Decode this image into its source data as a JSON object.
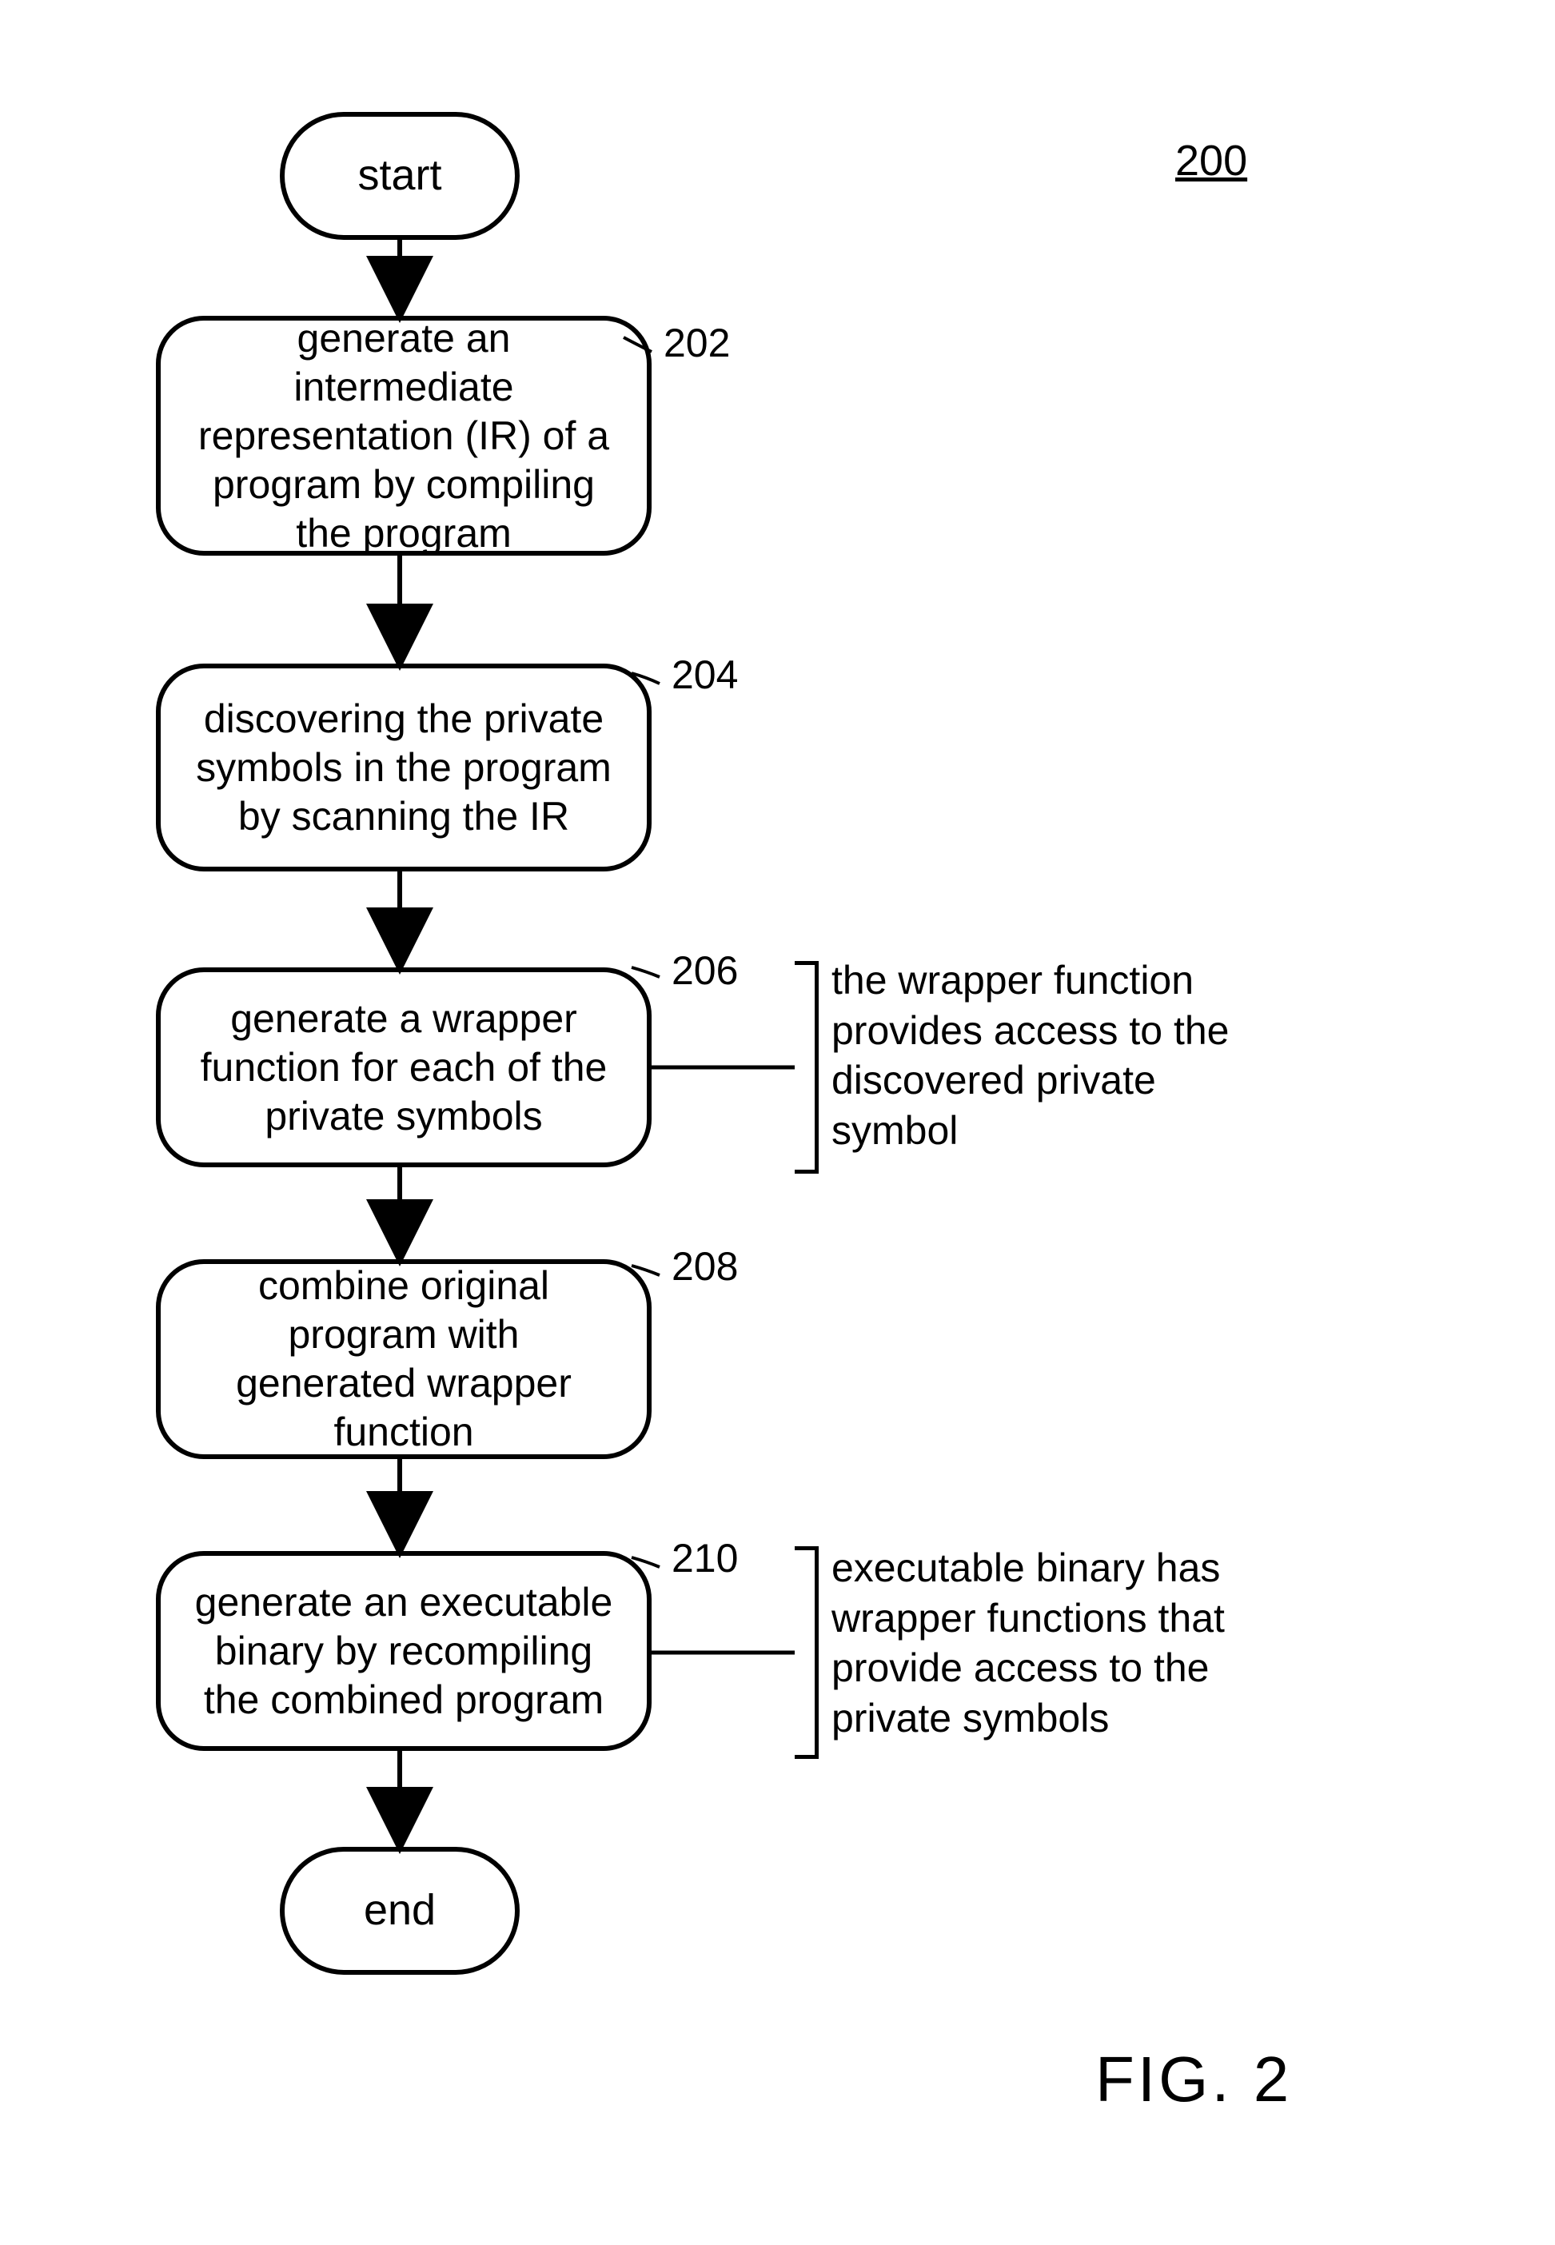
{
  "page_label": "200",
  "figure_label": "FIG. 2",
  "nodes": {
    "start": "start",
    "end": "end",
    "step202": {
      "label": "202",
      "text": "generate an intermediate representation (IR) of a program by compiling the program"
    },
    "step204": {
      "label": "204",
      "text": "discovering the private symbols in the program by scanning the IR"
    },
    "step206": {
      "label": "206",
      "text": "generate a wrapper function for each of the private symbols"
    },
    "step208": {
      "label": "208",
      "text": "combine original program with generated wrapper function"
    },
    "step210": {
      "label": "210",
      "text": "generate an executable binary by recompiling the combined program"
    }
  },
  "annotations": {
    "note206": "the wrapper function provides access to the discovered private symbol",
    "note210": "executable binary has wrapper functions that provide access to the private symbols"
  },
  "chart_data": {
    "type": "flowchart",
    "title": "FIG. 2",
    "reference_numeral": "200",
    "nodes": [
      {
        "id": "start",
        "kind": "terminal",
        "label": "start"
      },
      {
        "id": "202",
        "kind": "process",
        "label": "generate an intermediate representation (IR) of a program by compiling the program"
      },
      {
        "id": "204",
        "kind": "process",
        "label": "discovering the private symbols in the program by scanning the IR"
      },
      {
        "id": "206",
        "kind": "process",
        "label": "generate a wrapper function for each of the private symbols",
        "annotation": "the wrapper function provides access to the discovered private symbol"
      },
      {
        "id": "208",
        "kind": "process",
        "label": "combine original program with generated wrapper function"
      },
      {
        "id": "210",
        "kind": "process",
        "label": "generate an executable binary by recompiling the combined program",
        "annotation": "executable binary has wrapper functions that provide access to the private symbols"
      },
      {
        "id": "end",
        "kind": "terminal",
        "label": "end"
      }
    ],
    "edges": [
      [
        "start",
        "202"
      ],
      [
        "202",
        "204"
      ],
      [
        "204",
        "206"
      ],
      [
        "206",
        "208"
      ],
      [
        "208",
        "210"
      ],
      [
        "210",
        "end"
      ]
    ]
  }
}
